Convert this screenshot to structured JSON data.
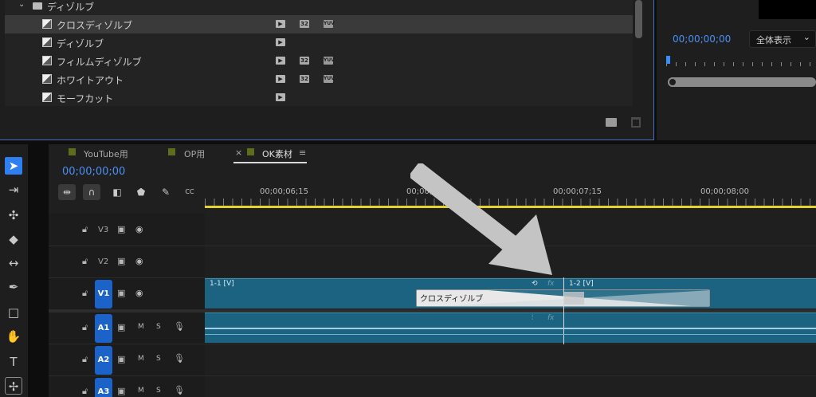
{
  "effects": {
    "folder_label": "ディゾルブ",
    "items": [
      {
        "label": "クロスディゾルブ",
        "selected": true,
        "badges": [
          "accel",
          "32",
          "yuv"
        ]
      },
      {
        "label": "ディゾルブ",
        "selected": false,
        "badges": [
          "accel"
        ]
      },
      {
        "label": "フィルムディゾルブ",
        "selected": false,
        "badges": [
          "accel",
          "32",
          "yuv"
        ]
      },
      {
        "label": "ホワイトアウト",
        "selected": false,
        "badges": [
          "accel",
          "32",
          "yuv"
        ]
      },
      {
        "label": "モーフカット",
        "selected": false,
        "badges": [
          "accel"
        ]
      }
    ],
    "badge_text": {
      "accel": "▶",
      "b32": "32",
      "yuv": "YUV"
    }
  },
  "program": {
    "timecode": "00;00;00;00",
    "fit_label": "全体表示",
    "fit_chevron": "⌄"
  },
  "tools": [
    "selection-tool",
    "track-select-tool",
    "ripple-edit-tool",
    "razor-tool",
    "slip-tool",
    "pen-tool",
    "rectangle-tool",
    "hand-tool",
    "type-tool",
    "ai-tool"
  ],
  "timeline": {
    "tabs": [
      {
        "label": "YouTube用",
        "color": "#5c6e1c"
      },
      {
        "label": "OP用",
        "color": "#5c6e1c"
      },
      {
        "label": "OK素材",
        "color": "#5c6e1c",
        "active": true,
        "close": "×",
        "menu": "≡"
      }
    ],
    "timecode": "00;00;00;00",
    "ruler_labels": [
      "00;00;06;15",
      "00;00;07;00",
      "00;00;07;15",
      "00;00;08;00"
    ],
    "tracks": [
      {
        "name": "V3",
        "kind": "video"
      },
      {
        "name": "V2",
        "kind": "video"
      },
      {
        "name": "V1",
        "kind": "video",
        "targeted": true
      },
      {
        "name": "A1",
        "kind": "audio",
        "targeted": true,
        "m": "M",
        "s": "S"
      },
      {
        "name": "A2",
        "kind": "audio",
        "targeted": true,
        "m": "M",
        "s": "S"
      },
      {
        "name": "A3",
        "kind": "audio",
        "targeted": true,
        "m": "M",
        "s": "S"
      }
    ],
    "clips": {
      "v1_left": "1-1 [V]",
      "v1_right": "1-2 [V]",
      "fx_badge": "fx"
    },
    "transition_label": "クロスディゾルブ"
  },
  "colors": {
    "accent": "#2f7ff2",
    "timecode": "#4a8ff6",
    "clip": "#1b6380",
    "work_area": "#e6d22c",
    "seq_label": "#5c6e1c"
  }
}
